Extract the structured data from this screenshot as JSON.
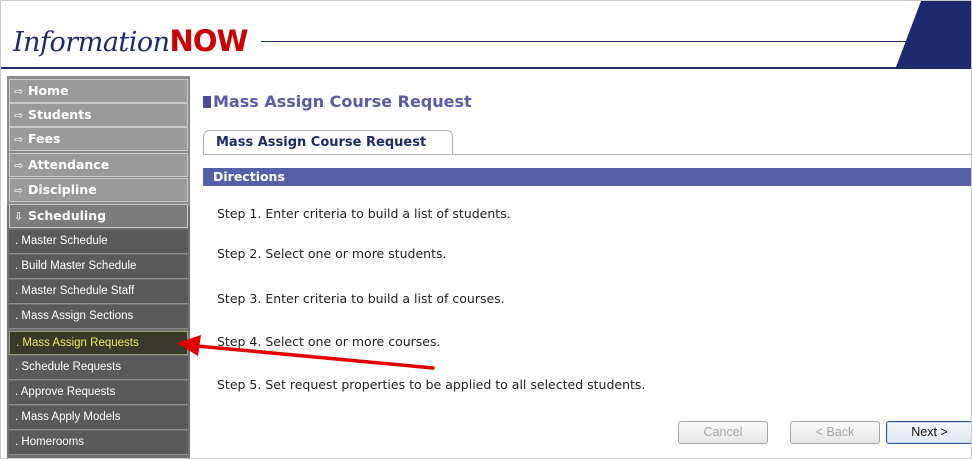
{
  "app": {
    "logo_part1": "Information",
    "logo_part2": "NOW"
  },
  "sidebar": {
    "main_items": [
      {
        "label": "Home",
        "icon": "right-arrow-icon"
      },
      {
        "label": "Students",
        "icon": "right-arrow-icon"
      },
      {
        "label": "Fees",
        "icon": "right-arrow-icon"
      },
      {
        "label": "Attendance",
        "icon": "right-arrow-icon"
      },
      {
        "label": "Discipline",
        "icon": "right-arrow-icon"
      },
      {
        "label": "Scheduling",
        "icon": "down-arrow-icon"
      }
    ],
    "sub_items": [
      ". Master Schedule",
      ". Build Master Schedule",
      ". Master Schedule Staff",
      ". Mass Assign Sections",
      ". Mass Assign Requests",
      ". Schedule Requests",
      ". Approve Requests",
      ". Mass Apply Models",
      ". Homerooms"
    ],
    "active_sub_index": 4
  },
  "main": {
    "title": "Mass Assign Course Request",
    "tab_label": "Mass Assign Course Request",
    "directions_label": "Directions",
    "steps": [
      "Step 1. Enter criteria to build a list of students.",
      "Step 2. Select one or more students.",
      "Step 3. Enter criteria to build a list of courses.",
      "Step 4. Select one or more courses.",
      "Step 5. Set request properties to be applied to all selected students."
    ]
  },
  "buttons": {
    "cancel": "Cancel",
    "back": "< Back",
    "next": "Next >"
  },
  "colors": {
    "accent": "#5660a8",
    "brand_red": "#cc0000",
    "navy": "#1e2a6e",
    "annotation": "#e00000"
  }
}
